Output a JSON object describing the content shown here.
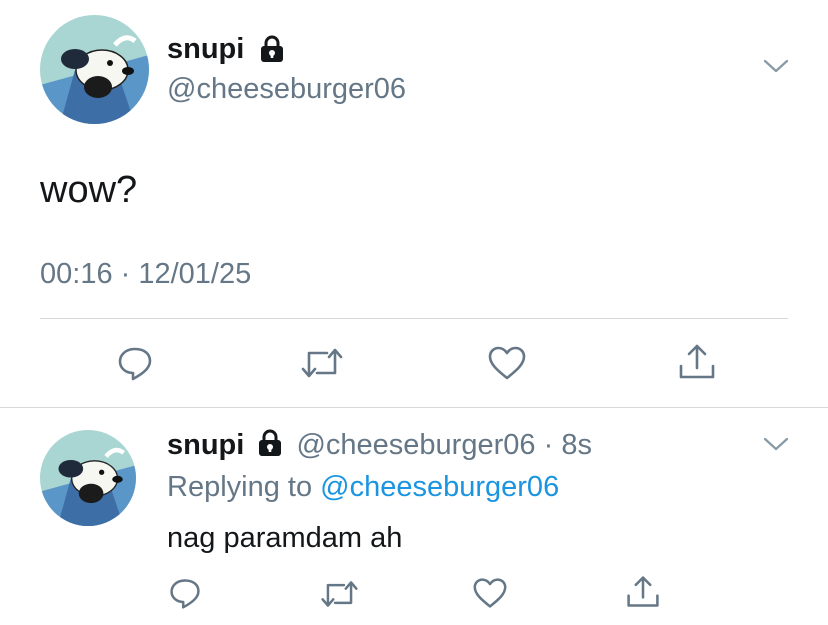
{
  "main_tweet": {
    "display_name": "snupi",
    "handle": "@cheeseburger06",
    "text": "wow?",
    "timestamp": "00:16 · 12/01/25",
    "avatar_icon": "snoopy-avatar",
    "locked_icon": "lock-icon",
    "menu_icon": "chevron-down-icon"
  },
  "reply_tweet": {
    "display_name": "snupi",
    "handle": "@cheeseburger06",
    "separator": "·",
    "time_ago": "8s",
    "replying_prefix": "Replying to",
    "replying_handle": "@cheeseburger06",
    "text": "nag paramdam ah",
    "avatar_icon": "snoopy-avatar",
    "locked_icon": "lock-icon",
    "menu_icon": "chevron-down-icon"
  },
  "actions": [
    "reply-icon",
    "retweet-icon",
    "like-icon",
    "share-icon"
  ],
  "colors": {
    "text": "#14171a",
    "secondary": "#657786",
    "link": "#1b95e0",
    "divider": "#d4d8db"
  }
}
